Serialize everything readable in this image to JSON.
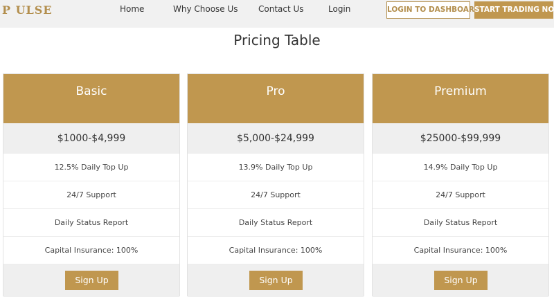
{
  "nav": {
    "logo": "P ULSE",
    "links": [
      "Home",
      "Why Choose Us",
      "Contact Us",
      "Login"
    ],
    "login_dashboard": "LOGIN TO DASHBOARD",
    "start_trading": "START TRADING NOW"
  },
  "page": {
    "title": "Pricing Table"
  },
  "plans": [
    {
      "name": "Basic",
      "price": "$1000-$4,999",
      "features": [
        "12.5% Daily Top Up",
        "24/7 Support",
        "Daily Status Report",
        "Capital Insurance: 100%"
      ],
      "cta": "Sign Up"
    },
    {
      "name": "Pro",
      "price": "$5,000-$24,999",
      "features": [
        "13.9% Daily Top Up",
        "24/7 Support",
        "Daily Status Report",
        "Capital Insurance: 100%"
      ],
      "cta": "Sign Up"
    },
    {
      "name": "Premium",
      "price": "$25000-$99,999",
      "features": [
        "14.9% Daily Top Up",
        "24/7 Support",
        "Daily Status Report",
        "Capital Insurance: 100%"
      ],
      "cta": "Sign Up"
    }
  ],
  "colors": {
    "accent": "#c0974f",
    "navbar_bg": "#f1f1f1",
    "row_bg": "#efefef"
  }
}
